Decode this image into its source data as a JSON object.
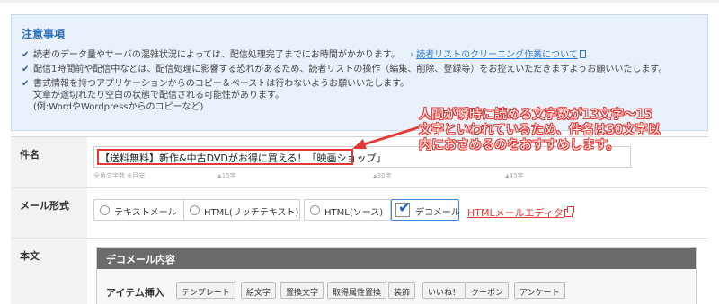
{
  "notice": {
    "title": "注意事項",
    "items": [
      {
        "text": "読者のデータ量やサーバの混雑状況によっては、配信処理完了までにお時間がかかります。",
        "link": "読者リストのクリーニング作業について"
      },
      {
        "text": "配信1時間前や配信中などは、配信処理に影響する恐れがあるため、読者リストの操作（編集、削除、登録等）をお控えいただきますようお願いいたします。"
      },
      {
        "text": "書式情報を持つアプリケーションからのコピー＆ペーストは行わないようお願いいたします。",
        "sub1": "文章が途切れたり空白の状態で配信される可能性があります。",
        "sub2": "(例:WordやWordpressからのコピーなど)"
      }
    ]
  },
  "form": {
    "subject": {
      "label": "件名",
      "value": "【送料無料】新作&中古DVDがお得に買える！「映画ショップ」",
      "ruler": {
        "hint": "全角文字数 ※目安",
        "m15": "15字",
        "m30": "30字",
        "m45": "45字"
      }
    },
    "mail_format": {
      "label": "メール形式",
      "options": [
        "テキストメール",
        "HTML(リッチテキスト)",
        "HTML(ソース)",
        "デコメール"
      ],
      "selected": "デコメール",
      "editor_link": "HTMLメールエディタ"
    },
    "body": {
      "label": "本文",
      "panel_title": "デコメール内容",
      "item_label": "アイテム挿入",
      "buttons": [
        "テンプレート",
        "絵文字",
        "置換文字",
        "取得属性置換",
        "装飾",
        "いいね！",
        "クーポン",
        "アンケート"
      ]
    }
  },
  "annotation": {
    "line1": "人間が瞬時に読める文字数が13文字〜15",
    "line2": "文字といわれているため、件名は30文字以",
    "line3": "内におさめるのをおすすめします。"
  },
  "colors": {
    "accent": "#2a6fb8",
    "highlight": "#e53935",
    "notice_bg": "#e9f2fa"
  }
}
